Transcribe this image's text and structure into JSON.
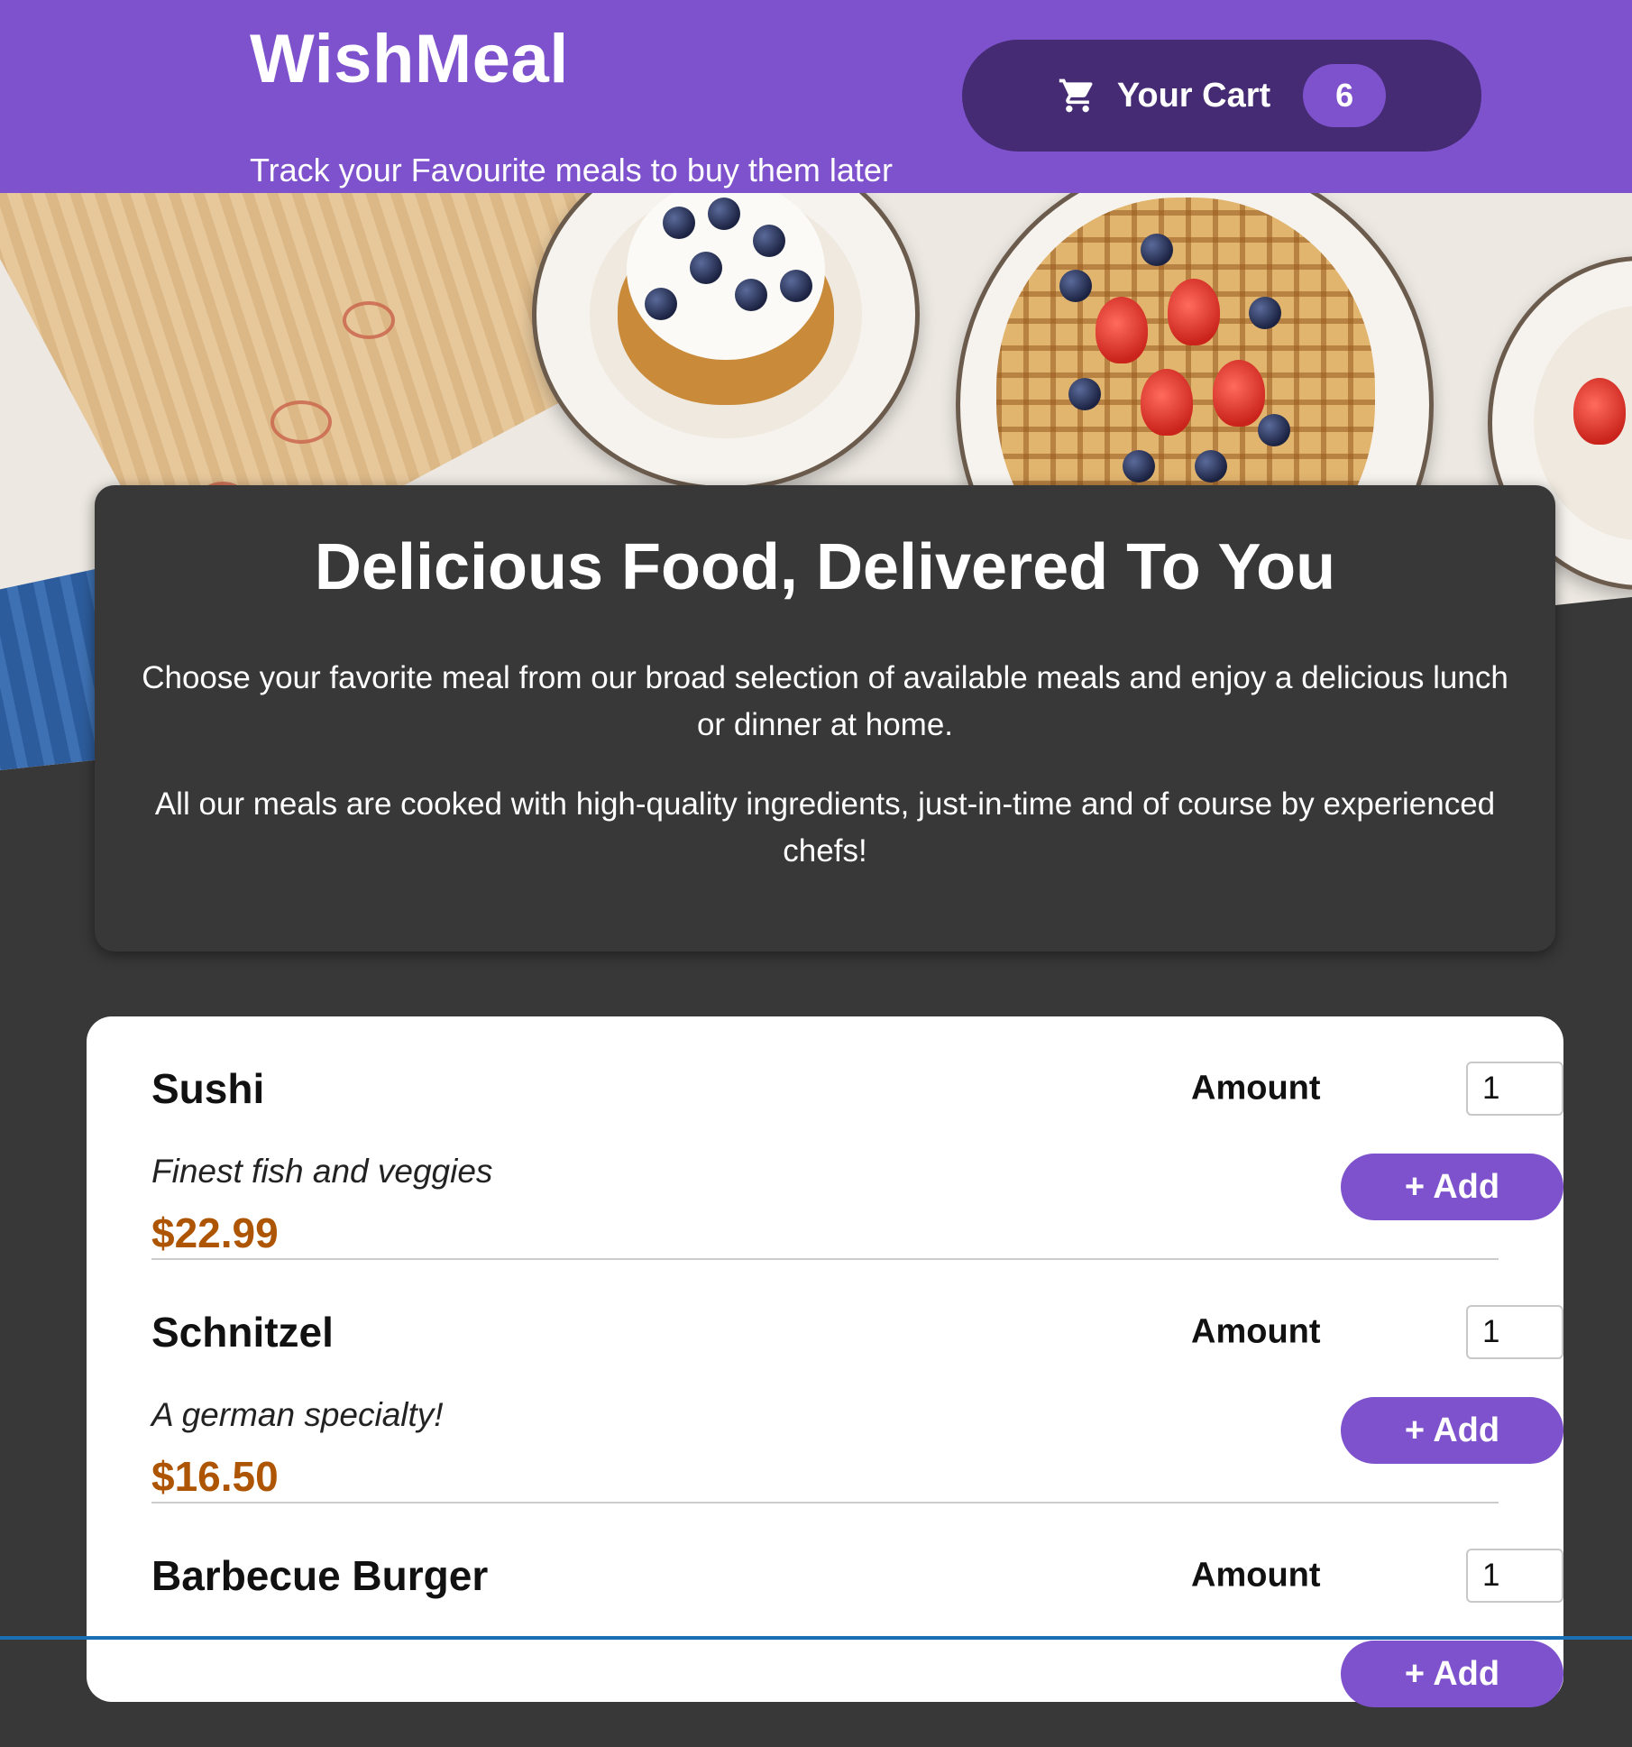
{
  "header": {
    "brand": "WishMeal",
    "tagline": "Track your Favourite meals to buy them later",
    "cart": {
      "label": "Your Cart",
      "count": "6",
      "icon": "cart-icon"
    }
  },
  "hero": {
    "image": "breakfast-table-photo"
  },
  "summary": {
    "title": "Delicious Food, Delivered To You",
    "paragraph1": "Choose your favorite meal from our broad selection of available meals and enjoy a delicious lunch or dinner at home.",
    "paragraph2": "All our meals are cooked with high-quality ingredients, just-in-time and of course by experienced chefs!"
  },
  "meals": [
    {
      "name": "Sushi",
      "description": "Finest fish and veggies",
      "price": "$22.99",
      "amount_label": "Amount",
      "amount": "1",
      "add_label": "+ Add"
    },
    {
      "name": "Schnitzel",
      "description": "A german specialty!",
      "price": "$16.50",
      "amount_label": "Amount",
      "amount": "1",
      "add_label": "+ Add"
    },
    {
      "name": "Barbecue Burger",
      "description": "",
      "price": "",
      "amount_label": "Amount",
      "amount": "1",
      "add_label": "+ Add"
    }
  ],
  "colors": {
    "accent": "#7e52cd",
    "cart_bg": "#442b74",
    "page_bg": "#383838",
    "price": "#ad5502"
  }
}
